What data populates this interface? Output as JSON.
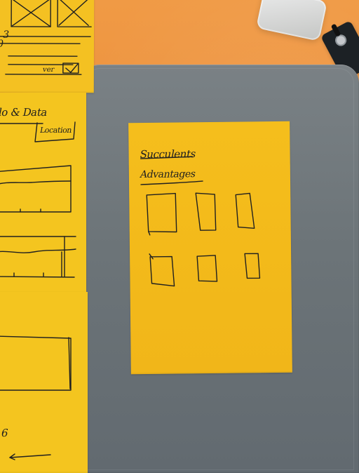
{
  "photo": {
    "center_note": {
      "title": "Succulents",
      "subtitle": "Advantages"
    },
    "left_notes": {
      "middle_title": "lo & Data",
      "middle_label": "Location",
      "top_text_1": "3",
      "top_text_2": "0",
      "top_small_label": "ver",
      "bottom_label": "6"
    }
  },
  "colors": {
    "desk": "#e98a38",
    "tablet": "#6c7478",
    "sticky": "#f4bf1d",
    "ink": "#1f1f1f"
  }
}
